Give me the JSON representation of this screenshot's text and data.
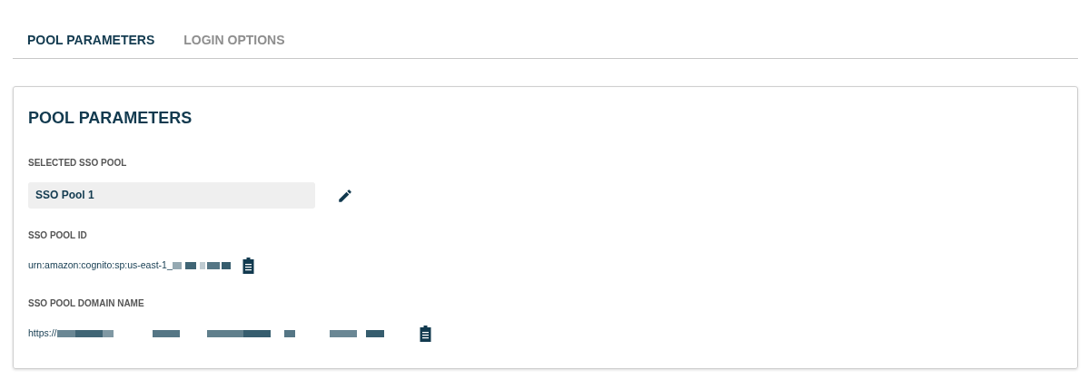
{
  "tabs": [
    {
      "label": "POOL PARAMETERS",
      "selected": true
    },
    {
      "label": "LOGIN OPTIONS",
      "selected": false
    }
  ],
  "panel": {
    "title": "POOL PARAMETERS",
    "fields": [
      {
        "kind": "select",
        "label": "SELECTED SSO POOL",
        "value": "SSO Pool 1"
      },
      {
        "kind": "copy",
        "label": "SSO POOL ID",
        "value": "urn:amazon:cognito:sp:us-east-1_",
        "redacted": true
      },
      {
        "kind": "copy",
        "label": "SSO POOL DOMAIN NAME",
        "value": "https://",
        "redacted": true
      }
    ]
  }
}
